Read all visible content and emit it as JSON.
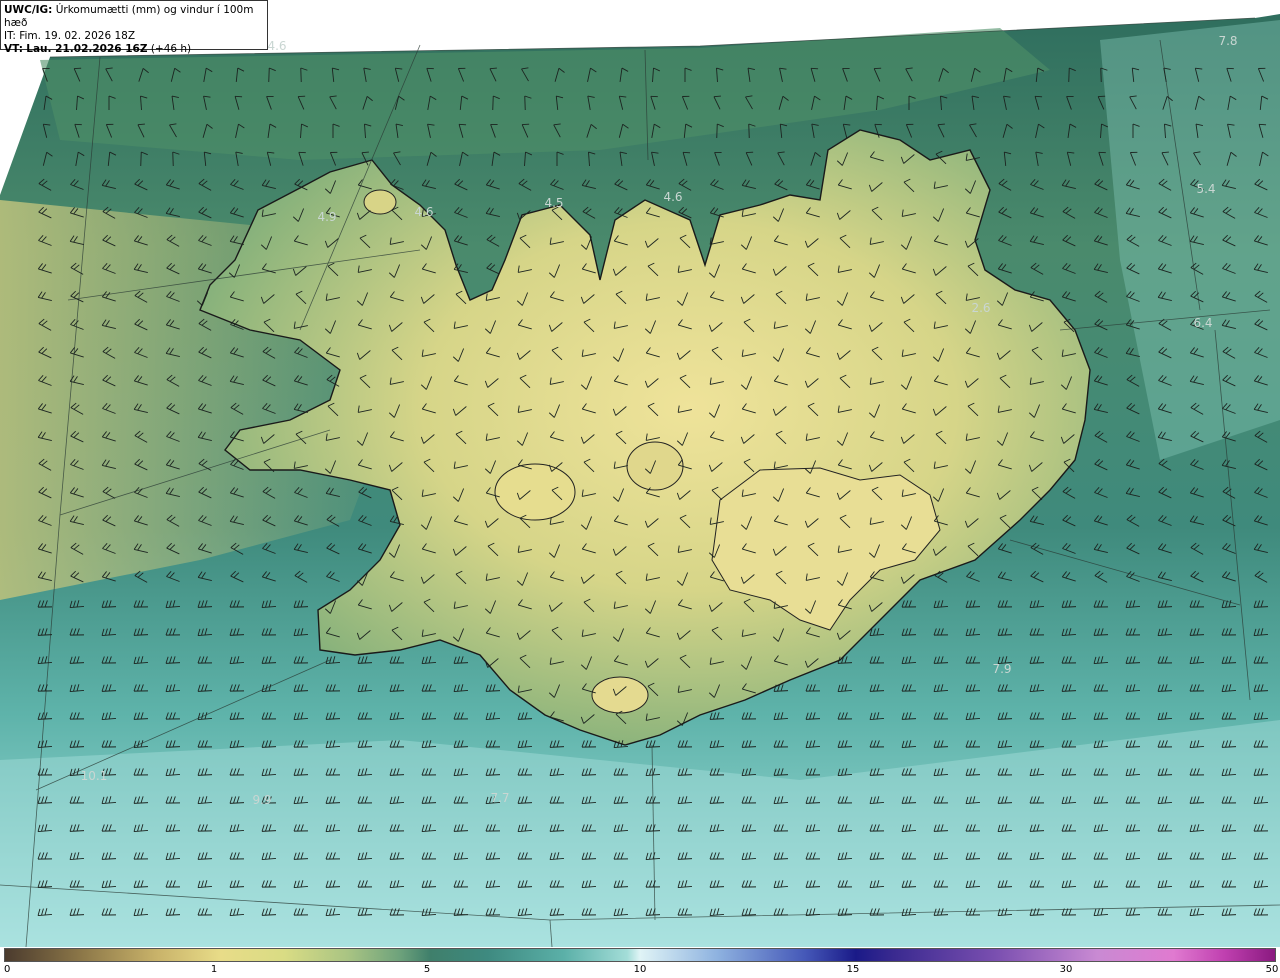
{
  "header": {
    "model": "UWC/IG:",
    "field": "Úrkomumætti (mm) og vindur í 100m hæð",
    "initial_time": "IT: Fim. 19. 02. 2026 18Z",
    "valid_prefix": "VT:",
    "valid_time": "Lau. 21.02.2026 16Z",
    "lead": "(+46 h)"
  },
  "value_labels": [
    "4.6",
    "4.9",
    "4.6",
    "4.5",
    "4.6",
    "7.8",
    "5.4",
    "6.4",
    "2.6",
    "7.9",
    "10.1",
    "9.9",
    "7.7"
  ],
  "colorbar": {
    "ticks": [
      "0",
      "1",
      "5",
      "10",
      "15",
      "30",
      "50"
    ]
  },
  "colors": {
    "ocean_dark": "#2f6e5e",
    "ocean_mid": "#3f8a7c",
    "ocean_light": "#8fd3d0",
    "land_low": "#6e9e70",
    "land_high": "#eadf8c"
  }
}
